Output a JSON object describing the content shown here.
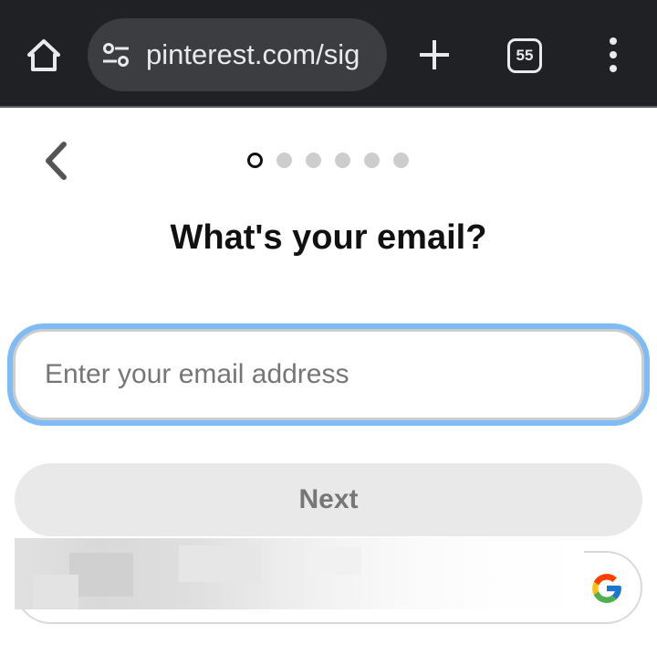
{
  "browser": {
    "url_display": "pinterest.com/sig",
    "tab_count": "55"
  },
  "signup": {
    "progress_total": 6,
    "progress_current": 1,
    "title": "What's your email?",
    "email_placeholder": "Enter your email address",
    "email_value": "",
    "next_label": "Next"
  },
  "icons": {
    "home": "home-icon",
    "site_settings": "tune-icon",
    "new_tab": "plus-icon",
    "menu": "more-vert-icon",
    "back": "chevron-left-icon",
    "google": "google-g-icon"
  },
  "colors": {
    "chrome_bg": "#202124",
    "focus_ring": "#7fbcf6",
    "button_disabled_bg": "#e9e9e9"
  }
}
